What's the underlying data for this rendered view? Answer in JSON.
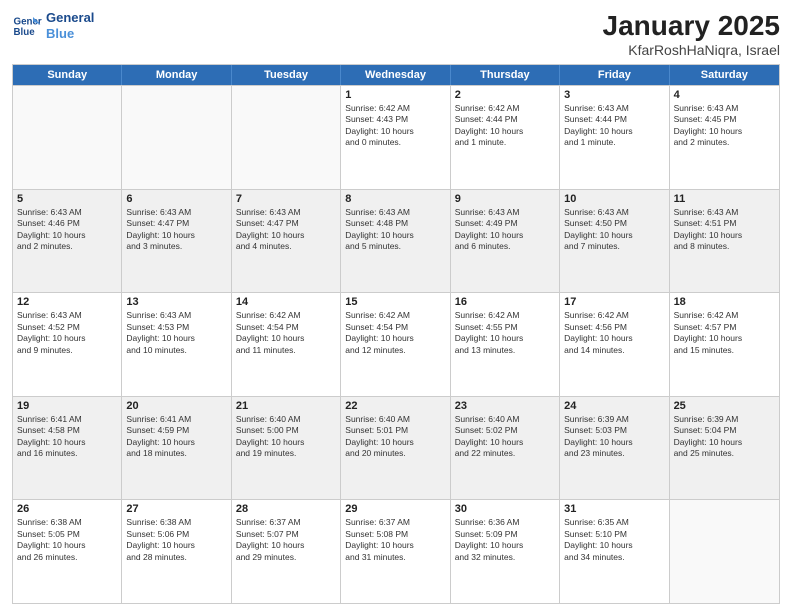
{
  "logo": {
    "line1": "General",
    "line2": "Blue"
  },
  "title": "January 2025",
  "subtitle": "KfarRoshHaNiqra, Israel",
  "weekdays": [
    "Sunday",
    "Monday",
    "Tuesday",
    "Wednesday",
    "Thursday",
    "Friday",
    "Saturday"
  ],
  "weeks": [
    [
      {
        "day": "",
        "info": "",
        "empty": true
      },
      {
        "day": "",
        "info": "",
        "empty": true
      },
      {
        "day": "",
        "info": "",
        "empty": true
      },
      {
        "day": "1",
        "info": "Sunrise: 6:42 AM\nSunset: 4:43 PM\nDaylight: 10 hours\nand 0 minutes.",
        "empty": false
      },
      {
        "day": "2",
        "info": "Sunrise: 6:42 AM\nSunset: 4:44 PM\nDaylight: 10 hours\nand 1 minute.",
        "empty": false
      },
      {
        "day": "3",
        "info": "Sunrise: 6:43 AM\nSunset: 4:44 PM\nDaylight: 10 hours\nand 1 minute.",
        "empty": false
      },
      {
        "day": "4",
        "info": "Sunrise: 6:43 AM\nSunset: 4:45 PM\nDaylight: 10 hours\nand 2 minutes.",
        "empty": false
      }
    ],
    [
      {
        "day": "5",
        "info": "Sunrise: 6:43 AM\nSunset: 4:46 PM\nDaylight: 10 hours\nand 2 minutes.",
        "empty": false
      },
      {
        "day": "6",
        "info": "Sunrise: 6:43 AM\nSunset: 4:47 PM\nDaylight: 10 hours\nand 3 minutes.",
        "empty": false
      },
      {
        "day": "7",
        "info": "Sunrise: 6:43 AM\nSunset: 4:47 PM\nDaylight: 10 hours\nand 4 minutes.",
        "empty": false
      },
      {
        "day": "8",
        "info": "Sunrise: 6:43 AM\nSunset: 4:48 PM\nDaylight: 10 hours\nand 5 minutes.",
        "empty": false
      },
      {
        "day": "9",
        "info": "Sunrise: 6:43 AM\nSunset: 4:49 PM\nDaylight: 10 hours\nand 6 minutes.",
        "empty": false
      },
      {
        "day": "10",
        "info": "Sunrise: 6:43 AM\nSunset: 4:50 PM\nDaylight: 10 hours\nand 7 minutes.",
        "empty": false
      },
      {
        "day": "11",
        "info": "Sunrise: 6:43 AM\nSunset: 4:51 PM\nDaylight: 10 hours\nand 8 minutes.",
        "empty": false
      }
    ],
    [
      {
        "day": "12",
        "info": "Sunrise: 6:43 AM\nSunset: 4:52 PM\nDaylight: 10 hours\nand 9 minutes.",
        "empty": false
      },
      {
        "day": "13",
        "info": "Sunrise: 6:43 AM\nSunset: 4:53 PM\nDaylight: 10 hours\nand 10 minutes.",
        "empty": false
      },
      {
        "day": "14",
        "info": "Sunrise: 6:42 AM\nSunset: 4:54 PM\nDaylight: 10 hours\nand 11 minutes.",
        "empty": false
      },
      {
        "day": "15",
        "info": "Sunrise: 6:42 AM\nSunset: 4:54 PM\nDaylight: 10 hours\nand 12 minutes.",
        "empty": false
      },
      {
        "day": "16",
        "info": "Sunrise: 6:42 AM\nSunset: 4:55 PM\nDaylight: 10 hours\nand 13 minutes.",
        "empty": false
      },
      {
        "day": "17",
        "info": "Sunrise: 6:42 AM\nSunset: 4:56 PM\nDaylight: 10 hours\nand 14 minutes.",
        "empty": false
      },
      {
        "day": "18",
        "info": "Sunrise: 6:42 AM\nSunset: 4:57 PM\nDaylight: 10 hours\nand 15 minutes.",
        "empty": false
      }
    ],
    [
      {
        "day": "19",
        "info": "Sunrise: 6:41 AM\nSunset: 4:58 PM\nDaylight: 10 hours\nand 16 minutes.",
        "empty": false
      },
      {
        "day": "20",
        "info": "Sunrise: 6:41 AM\nSunset: 4:59 PM\nDaylight: 10 hours\nand 18 minutes.",
        "empty": false
      },
      {
        "day": "21",
        "info": "Sunrise: 6:40 AM\nSunset: 5:00 PM\nDaylight: 10 hours\nand 19 minutes.",
        "empty": false
      },
      {
        "day": "22",
        "info": "Sunrise: 6:40 AM\nSunset: 5:01 PM\nDaylight: 10 hours\nand 20 minutes.",
        "empty": false
      },
      {
        "day": "23",
        "info": "Sunrise: 6:40 AM\nSunset: 5:02 PM\nDaylight: 10 hours\nand 22 minutes.",
        "empty": false
      },
      {
        "day": "24",
        "info": "Sunrise: 6:39 AM\nSunset: 5:03 PM\nDaylight: 10 hours\nand 23 minutes.",
        "empty": false
      },
      {
        "day": "25",
        "info": "Sunrise: 6:39 AM\nSunset: 5:04 PM\nDaylight: 10 hours\nand 25 minutes.",
        "empty": false
      }
    ],
    [
      {
        "day": "26",
        "info": "Sunrise: 6:38 AM\nSunset: 5:05 PM\nDaylight: 10 hours\nand 26 minutes.",
        "empty": false
      },
      {
        "day": "27",
        "info": "Sunrise: 6:38 AM\nSunset: 5:06 PM\nDaylight: 10 hours\nand 28 minutes.",
        "empty": false
      },
      {
        "day": "28",
        "info": "Sunrise: 6:37 AM\nSunset: 5:07 PM\nDaylight: 10 hours\nand 29 minutes.",
        "empty": false
      },
      {
        "day": "29",
        "info": "Sunrise: 6:37 AM\nSunset: 5:08 PM\nDaylight: 10 hours\nand 31 minutes.",
        "empty": false
      },
      {
        "day": "30",
        "info": "Sunrise: 6:36 AM\nSunset: 5:09 PM\nDaylight: 10 hours\nand 32 minutes.",
        "empty": false
      },
      {
        "day": "31",
        "info": "Sunrise: 6:35 AM\nSunset: 5:10 PM\nDaylight: 10 hours\nand 34 minutes.",
        "empty": false
      },
      {
        "day": "",
        "info": "",
        "empty": true
      }
    ]
  ]
}
